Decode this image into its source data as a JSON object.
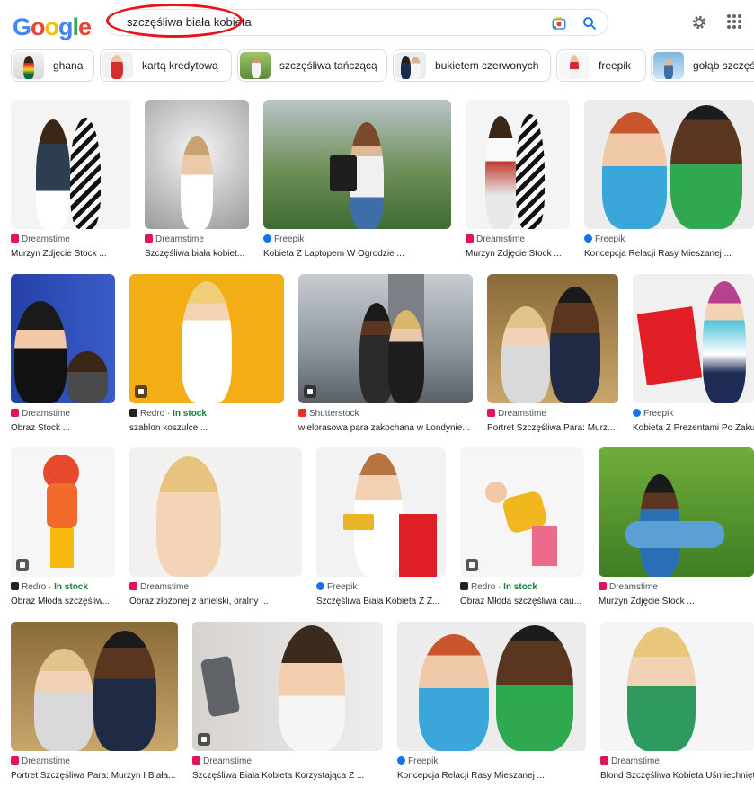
{
  "header": {
    "logo_letters": [
      "G",
      "o",
      "o",
      "g",
      "l",
      "e"
    ],
    "search_query": "szczęśliwa biała kobieta"
  },
  "icons": {
    "camera": "lens-camera-icon",
    "search": "search-icon",
    "settings": "gear-icon",
    "apps": "apps-grid-icon"
  },
  "colors": {
    "accent": "#1a73e8",
    "annotation_circle": "#e8141b",
    "in_stock": "#188038"
  },
  "chips": [
    {
      "label": "ghana"
    },
    {
      "label": "kartą kredytową"
    },
    {
      "label": "szczęśliwa tańczącą"
    },
    {
      "label": "bukietem czerwonych"
    },
    {
      "label": "freepik"
    },
    {
      "label": "gołąb szczęścia"
    }
  ],
  "results": [
    {
      "source": "Dreamstime",
      "caption": "Murzyn Zdjęcie Stock ..."
    },
    {
      "source": "Dreamstime",
      "caption": "Szczęśliwa biała kobiet..."
    },
    {
      "source": "Freepik",
      "caption": "Kobieta Z Laptopem W Ogrodzie ..."
    },
    {
      "source": "Dreamstime",
      "caption": "Murzyn Zdjęcie Stock ..."
    },
    {
      "source": "Freepik",
      "caption": "Koncepcja Relacji Rasy Mieszanej ..."
    },
    {
      "source": "Dreamstime",
      "caption": "Obraz Stock ..."
    },
    {
      "source": "Redro",
      "stock": "In stock",
      "caption": "szablon koszulce ..."
    },
    {
      "source": "Shutterstock",
      "caption": "wielorasowa para zakochana w Londynie..."
    },
    {
      "source": "Dreamstime",
      "caption": "Portret Szczęśliwa Para: Murz..."
    },
    {
      "source": "Freepik",
      "caption": "Kobieta Z Prezentami Po Zakupach"
    },
    {
      "source": "Redro",
      "stock": "In stock",
      "caption": "Obraz Młoda szczęśliw..."
    },
    {
      "source": "Dreamstime",
      "caption": "Obraz złożonej z anielski, oralny ..."
    },
    {
      "source": "Freepik",
      "caption": "Szczęśliwa Biała Kobieta Z Z..."
    },
    {
      "source": "Redro",
      "stock": "In stock",
      "caption": "Obraz Młoda szczęśliwa cau..."
    },
    {
      "source": "Dreamstime",
      "caption": "Murzyn Zdjęcie Stock ..."
    },
    {
      "source": "Dreamstime",
      "caption": "Portret Szczęśliwa Para: Murzyn I Biała..."
    },
    {
      "source": "Dreamstime",
      "caption": "Szczęśliwa Biała Kobieta Korzystająca Z ..."
    },
    {
      "source": "Freepik",
      "caption": "Koncepcja Relacji Rasy Mieszanej ..."
    },
    {
      "source": "Dreamstime",
      "caption": "Blond Szczęśliwa Kobieta Uśmiechnięta"
    }
  ]
}
